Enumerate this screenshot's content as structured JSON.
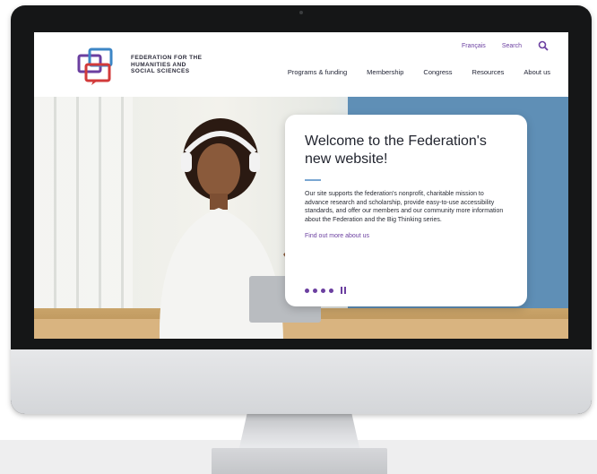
{
  "header": {
    "logo_lines": [
      "FEDERATION FOR THE",
      "HUMANITIES AND",
      "SOCIAL SCIENCES"
    ],
    "utility": {
      "link1": "Français",
      "link2": "Search",
      "search_icon": "search-icon"
    },
    "nav": [
      "Programs & funding",
      "Membership",
      "Congress",
      "Resources",
      "About us"
    ]
  },
  "hero": {
    "title": "Welcome to the Federation's new website!",
    "body": "Our site supports the federation's nonprofit, charitable mission to advance research and scholarship, provide easy-to-use accessibility standards, and offer our members and our community more information about the Federation and the Big Thinking series.",
    "link": "Find out more about us",
    "slides": 4,
    "pause_icon": "pause-icon"
  },
  "colors": {
    "accent": "#6b3fa0",
    "brand_blue": "#5f8fb6"
  }
}
